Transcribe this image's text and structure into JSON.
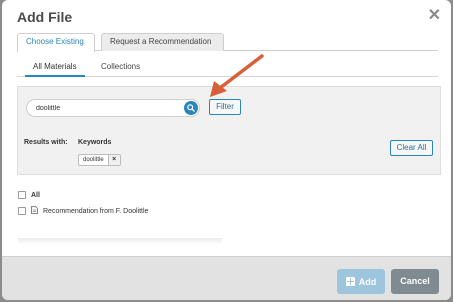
{
  "modal": {
    "title": "Add File",
    "close_icon": "close-icon"
  },
  "top_tabs": [
    {
      "label": "Choose Existing",
      "active": true
    },
    {
      "label": "Request a Recommendation",
      "active": false
    }
  ],
  "sub_tabs": [
    {
      "label": "All Materials",
      "active": true
    },
    {
      "label": "Collections",
      "active": false
    }
  ],
  "search": {
    "value": "doolittle",
    "placeholder": "",
    "button_icon": "search-icon",
    "filter_label": "Filter"
  },
  "results": {
    "label": "Results with:",
    "keywords_label": "Keywords",
    "keywords": [
      {
        "text": "doolittle",
        "remove_icon": "remove-x-icon"
      }
    ],
    "clear_all_label": "Clear All"
  },
  "list": {
    "all_label": "All",
    "items": [
      {
        "label": "Recommendation from F. Doolittle",
        "icon": "document-icon"
      }
    ]
  },
  "footer": {
    "add_label": "Add",
    "add_icon": "plus-square-icon",
    "cancel_label": "Cancel"
  },
  "colors": {
    "accent": "#2a86b8",
    "add_button": "#9dc5de",
    "cancel_button": "#7f8a91",
    "annotation_arrow": "#d95f3a"
  }
}
